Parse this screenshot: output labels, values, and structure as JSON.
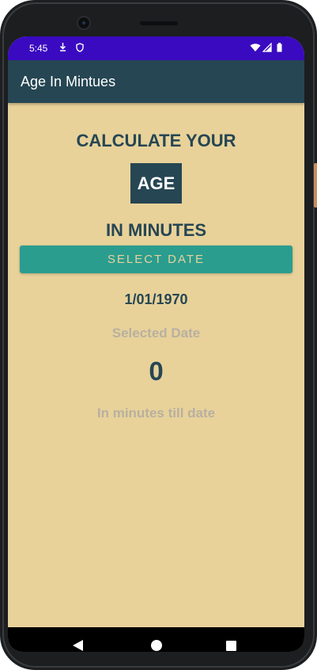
{
  "status_bar": {
    "time": "5:45",
    "left_icons": [
      "download-icon",
      "shield-icon"
    ],
    "right_icons": [
      "wifi-icon",
      "signal-icon",
      "battery-icon"
    ]
  },
  "app_bar": {
    "title": "Age In Mintues"
  },
  "main": {
    "heading_top": "CALCULATE YOUR",
    "age_badge": "AGE",
    "heading_bottom": "IN MINUTES",
    "select_button_label": "SELECT DATE",
    "selected_date_value": "1/01/1970",
    "selected_date_label": "Selected Date",
    "minutes_value": "0",
    "minutes_label": "In minutes till date"
  },
  "nav_bar": {
    "icons": [
      "back-icon",
      "home-icon",
      "recents-icon"
    ]
  },
  "colors": {
    "status_bar": "#3a0ac0",
    "app_bar": "#264653",
    "background": "#e8d29a",
    "accent_button": "#2a9d8f",
    "primary_text": "#264653",
    "muted_text": "#b8b0a0"
  }
}
